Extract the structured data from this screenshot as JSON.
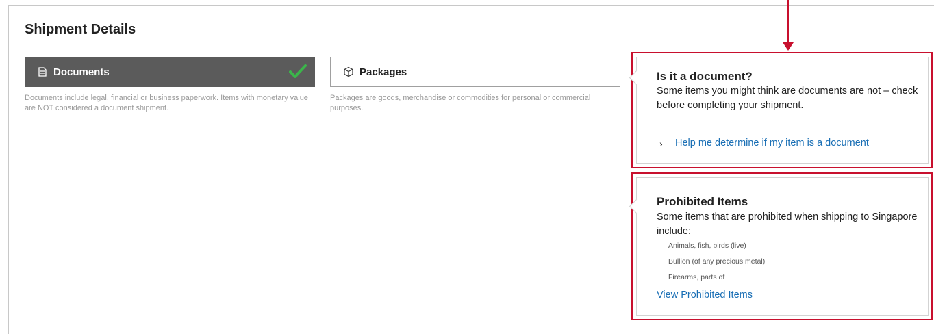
{
  "page": {
    "title": "Shipment Details"
  },
  "options": {
    "documents": {
      "label": "Documents",
      "selected": true,
      "description": "Documents include legal, financial or business paperwork. Items with monetary value are NOT considered a document shipment."
    },
    "packages": {
      "label": "Packages",
      "selected": false,
      "description": "Packages are goods, merchandise or commodities for personal or commercial purposes."
    }
  },
  "document_help": {
    "title": "Is it a document?",
    "body": "Some items you might think are documents are not – check before completing your shipment.",
    "link": "Help me determine if my item is a document"
  },
  "prohibited": {
    "title": "Prohibited Items",
    "body": "Some items that are prohibited when shipping to Singapore include:",
    "items": [
      "Animals, fish, birds (live)",
      "Bullion (of any precious metal)",
      "Firearms, parts of"
    ],
    "link": "View Prohibited Items"
  },
  "colors": {
    "accent": "#c8102e",
    "link": "#1a6fb5",
    "selected_bg": "#5b5b5b",
    "check": "#3bb54a"
  }
}
